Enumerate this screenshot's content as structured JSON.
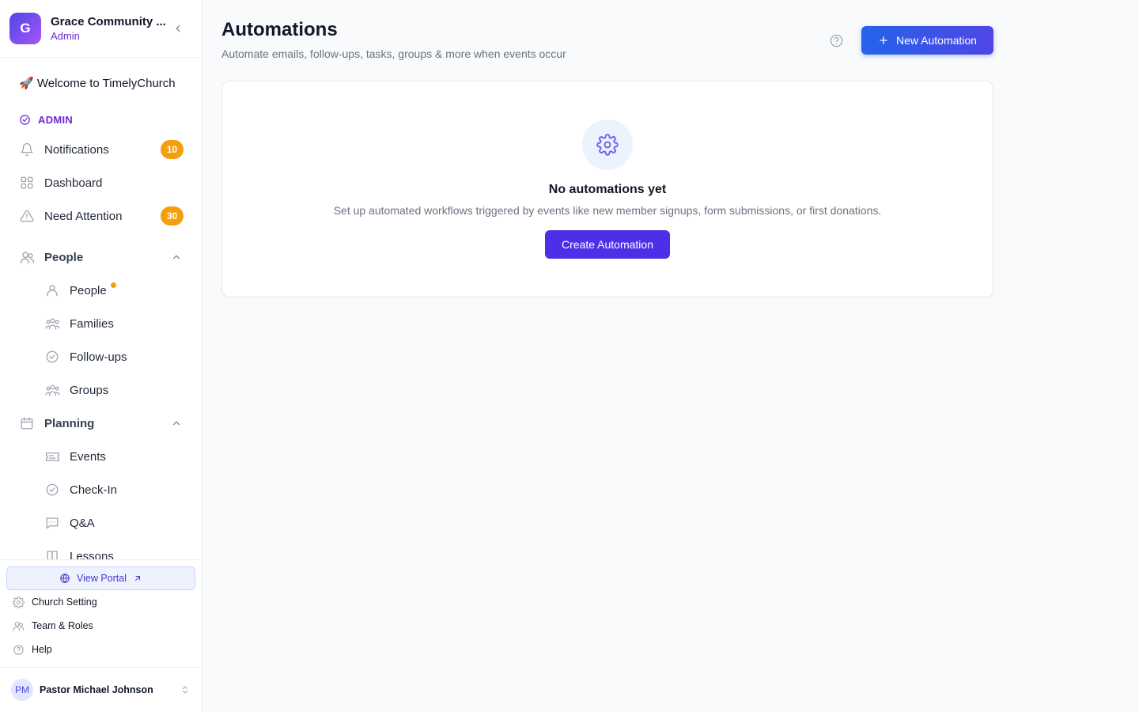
{
  "org": {
    "logo_letter": "G",
    "name": "Grace Community ...",
    "role": "Admin"
  },
  "sidebar": {
    "welcome": "🚀 Welcome to TimelyChurch",
    "admin_section_label": "ADMIN",
    "top_items": [
      {
        "label": "Notifications",
        "icon": "bell-icon",
        "badge": "10"
      },
      {
        "label": "Dashboard",
        "icon": "grid-icon"
      },
      {
        "label": "Need Attention",
        "icon": "warning-icon",
        "badge": "30"
      }
    ],
    "people_group": {
      "label": "People",
      "icon": "users-icon",
      "expanded": true,
      "items": [
        {
          "label": "People",
          "icon": "user-icon",
          "has_dot": true
        },
        {
          "label": "Families",
          "icon": "family-icon"
        },
        {
          "label": "Follow-ups",
          "icon": "check-circle-icon"
        },
        {
          "label": "Groups",
          "icon": "groups-icon"
        }
      ]
    },
    "planning_group": {
      "label": "Planning",
      "icon": "calendar-icon",
      "expanded": true,
      "items": [
        {
          "label": "Events",
          "icon": "ticket-icon"
        },
        {
          "label": "Check-In",
          "icon": "check-circle-icon"
        },
        {
          "label": "Q&A",
          "icon": "chat-icon"
        },
        {
          "label": "Lessons",
          "icon": "book-icon"
        }
      ]
    },
    "portal_button": "View Portal",
    "utility_items": [
      {
        "label": "Church Setting",
        "icon": "gear-icon"
      },
      {
        "label": "Team & Roles",
        "icon": "users-icon"
      },
      {
        "label": "Help",
        "icon": "help-circle-icon"
      }
    ],
    "user": {
      "initials": "PM",
      "name": "Pastor Michael Johnson"
    }
  },
  "main": {
    "title": "Automations",
    "subtitle": "Automate emails, follow-ups, tasks, groups & more when events occur",
    "new_button": "New Automation",
    "empty_state": {
      "title": "No automations yet",
      "description": "Set up automated workflows triggered by events like new member signups, form submissions, or first donations.",
      "button": "Create Automation"
    }
  },
  "colors": {
    "brand_purple": "#4f2ee8",
    "brand_blue": "#2563eb",
    "badge_orange": "#f59e0b",
    "admin_violet": "#6d28d9"
  }
}
